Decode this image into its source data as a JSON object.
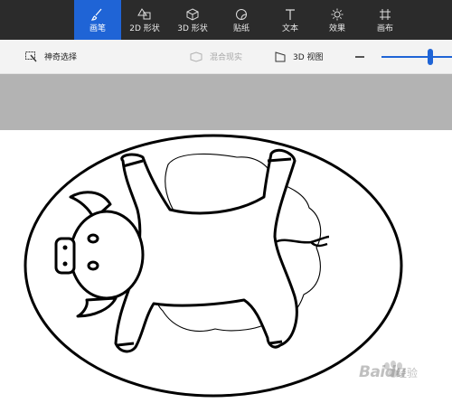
{
  "toolbar": {
    "tabs": [
      {
        "label": "画笔",
        "icon": "brush-icon",
        "active": true
      },
      {
        "label": "2D 形状",
        "icon": "2d-shapes-icon"
      },
      {
        "label": "3D 形状",
        "icon": "3d-shapes-icon"
      },
      {
        "label": "贴纸",
        "icon": "sticker-icon"
      },
      {
        "label": "文本",
        "icon": "text-icon"
      },
      {
        "label": "效果",
        "icon": "effects-icon"
      },
      {
        "label": "画布",
        "icon": "canvas-icon"
      }
    ],
    "accent_color": "#1f64d6",
    "background_color": "#2b2b2b"
  },
  "subbar": {
    "magic_select": {
      "label": "神奇选择",
      "icon": "magic-select-icon"
    },
    "mixed_reality": {
      "label": "混合现实",
      "icon": "mixed-reality-icon",
      "disabled": true
    },
    "view_3d": {
      "label": "3D 视图",
      "icon": "3d-view-icon"
    },
    "zoom_out": {
      "icon": "minus-icon"
    },
    "zoom_slider": {
      "value": 0.66
    }
  },
  "canvas": {
    "drawing": "pig-in-oval-icon",
    "watermark": {
      "brand": "Baidu",
      "suffix": "经验"
    }
  }
}
